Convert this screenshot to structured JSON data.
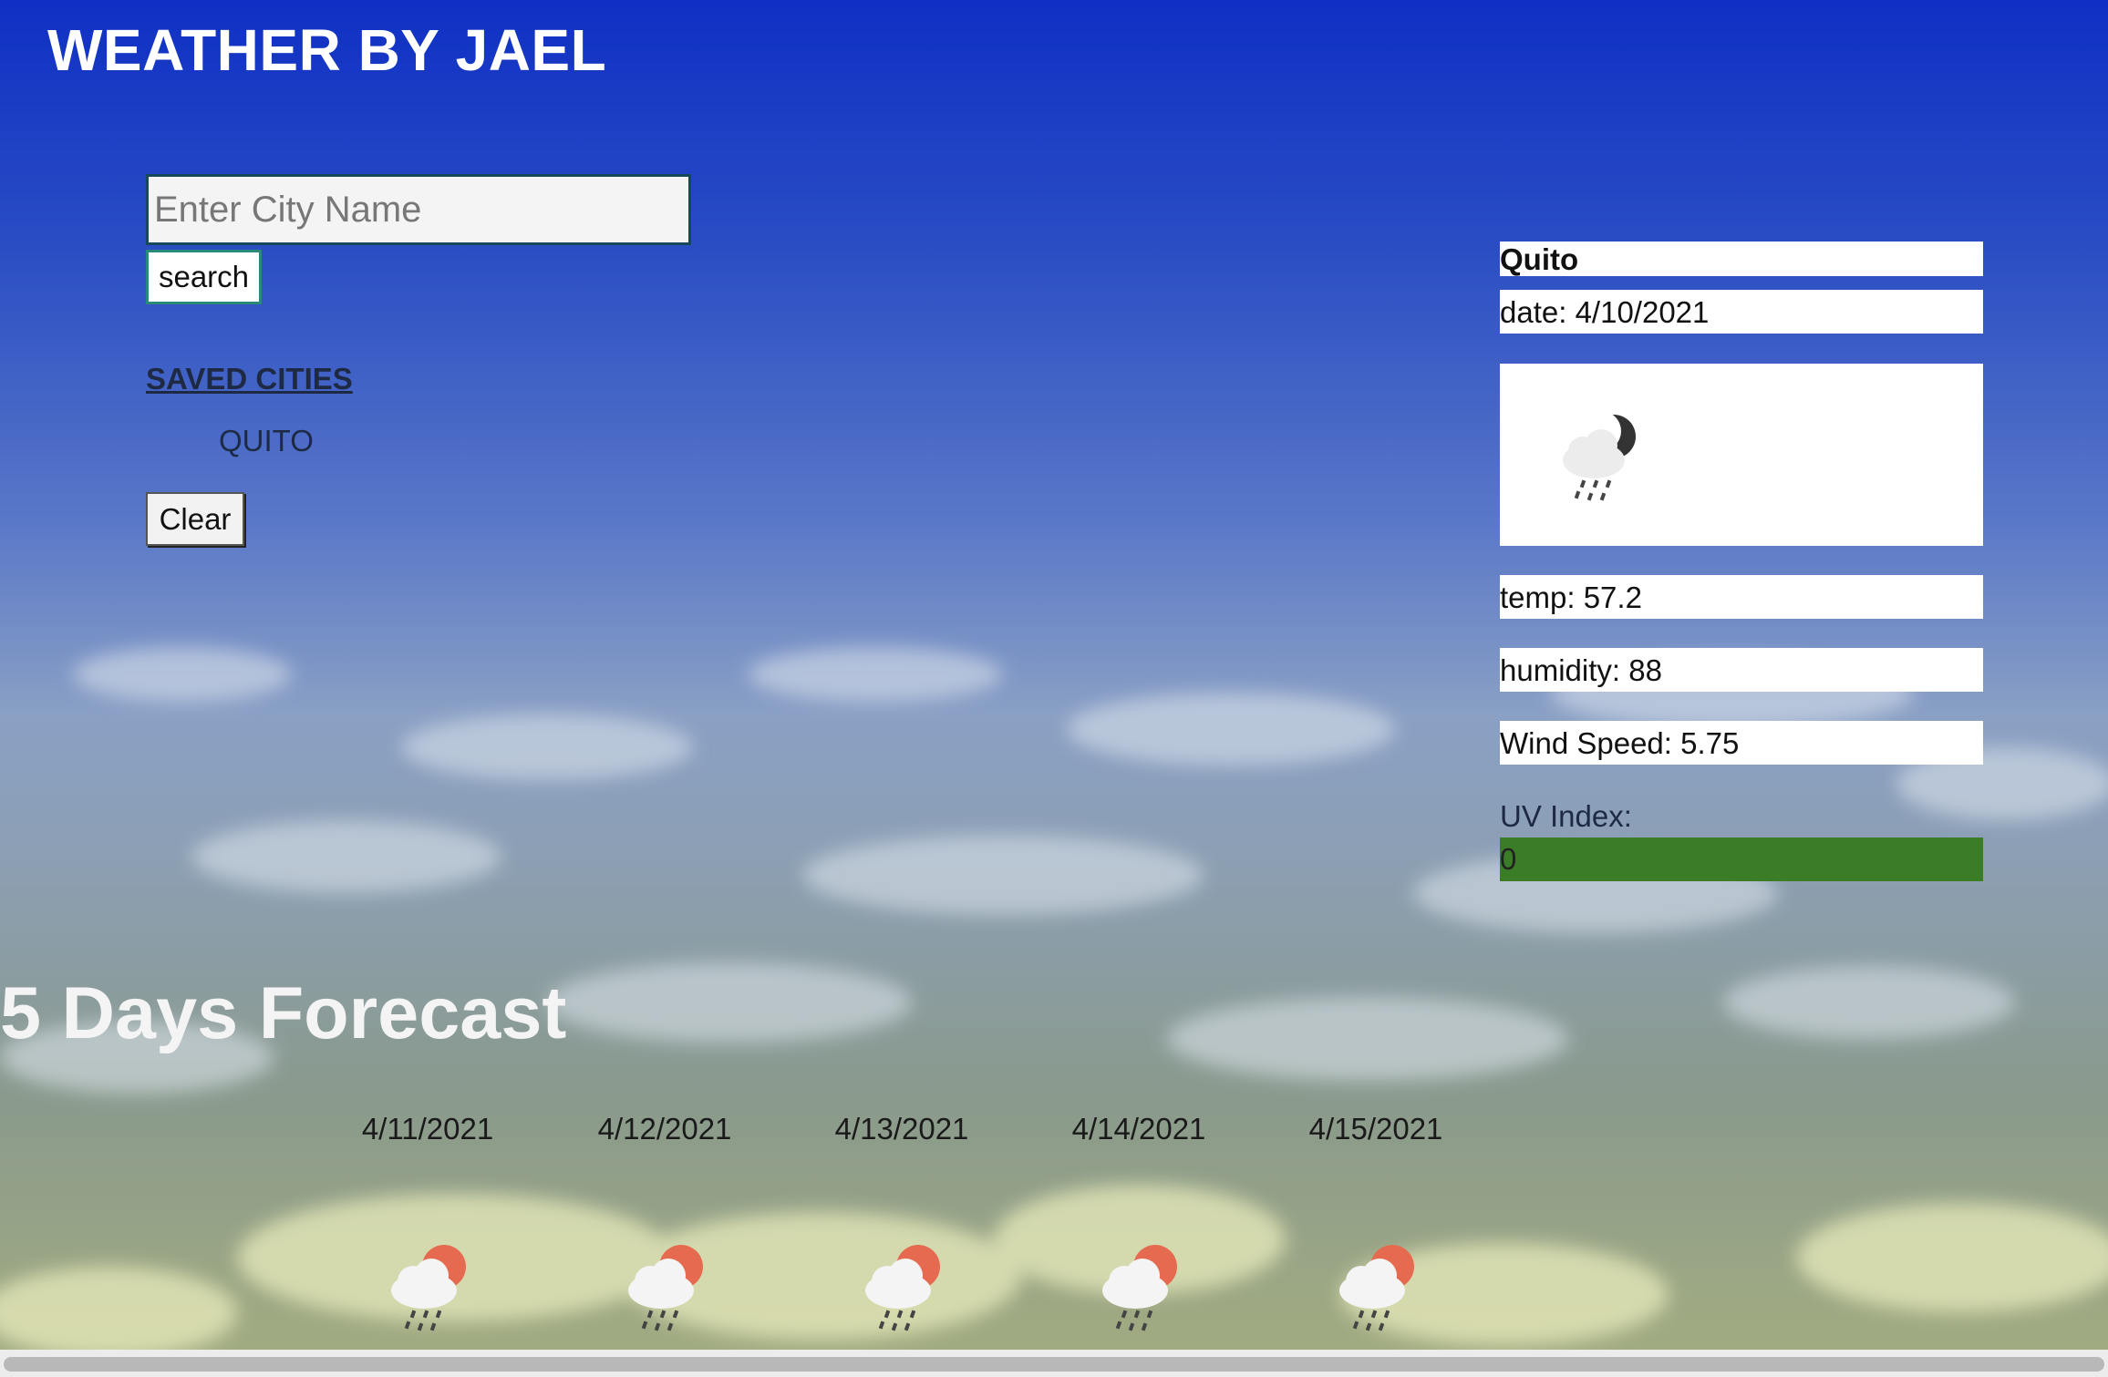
{
  "app": {
    "title": "WEATHER BY JAEL"
  },
  "search": {
    "placeholder": "Enter City Name",
    "value": "",
    "button_label": "search"
  },
  "saved": {
    "heading": "SAVED CITIES",
    "cities": [
      "QUITO"
    ],
    "clear_label": "Clear"
  },
  "current": {
    "city": "Quito",
    "date_text": "date: 4/10/2021",
    "icon": "night-rain-icon",
    "temp_text": "temp: 57.2",
    "humidity_text": "humidity: 88",
    "wind_text": "Wind Speed: 5.75",
    "uv_label": "UV Index:",
    "uv_value": "0",
    "uv_color": "#3a7d26"
  },
  "forecast": {
    "title": "5 Days Forecast",
    "days": [
      {
        "date": "4/11/2021",
        "icon": "day-rain-icon"
      },
      {
        "date": "4/12/2021",
        "icon": "day-rain-icon"
      },
      {
        "date": "4/13/2021",
        "icon": "day-rain-icon"
      },
      {
        "date": "4/14/2021",
        "icon": "day-rain-icon"
      },
      {
        "date": "4/15/2021",
        "icon": "day-rain-icon"
      }
    ]
  },
  "colors": {
    "title_text": "#ffffff",
    "sun": "#e56a4f",
    "moon": "#333333"
  }
}
